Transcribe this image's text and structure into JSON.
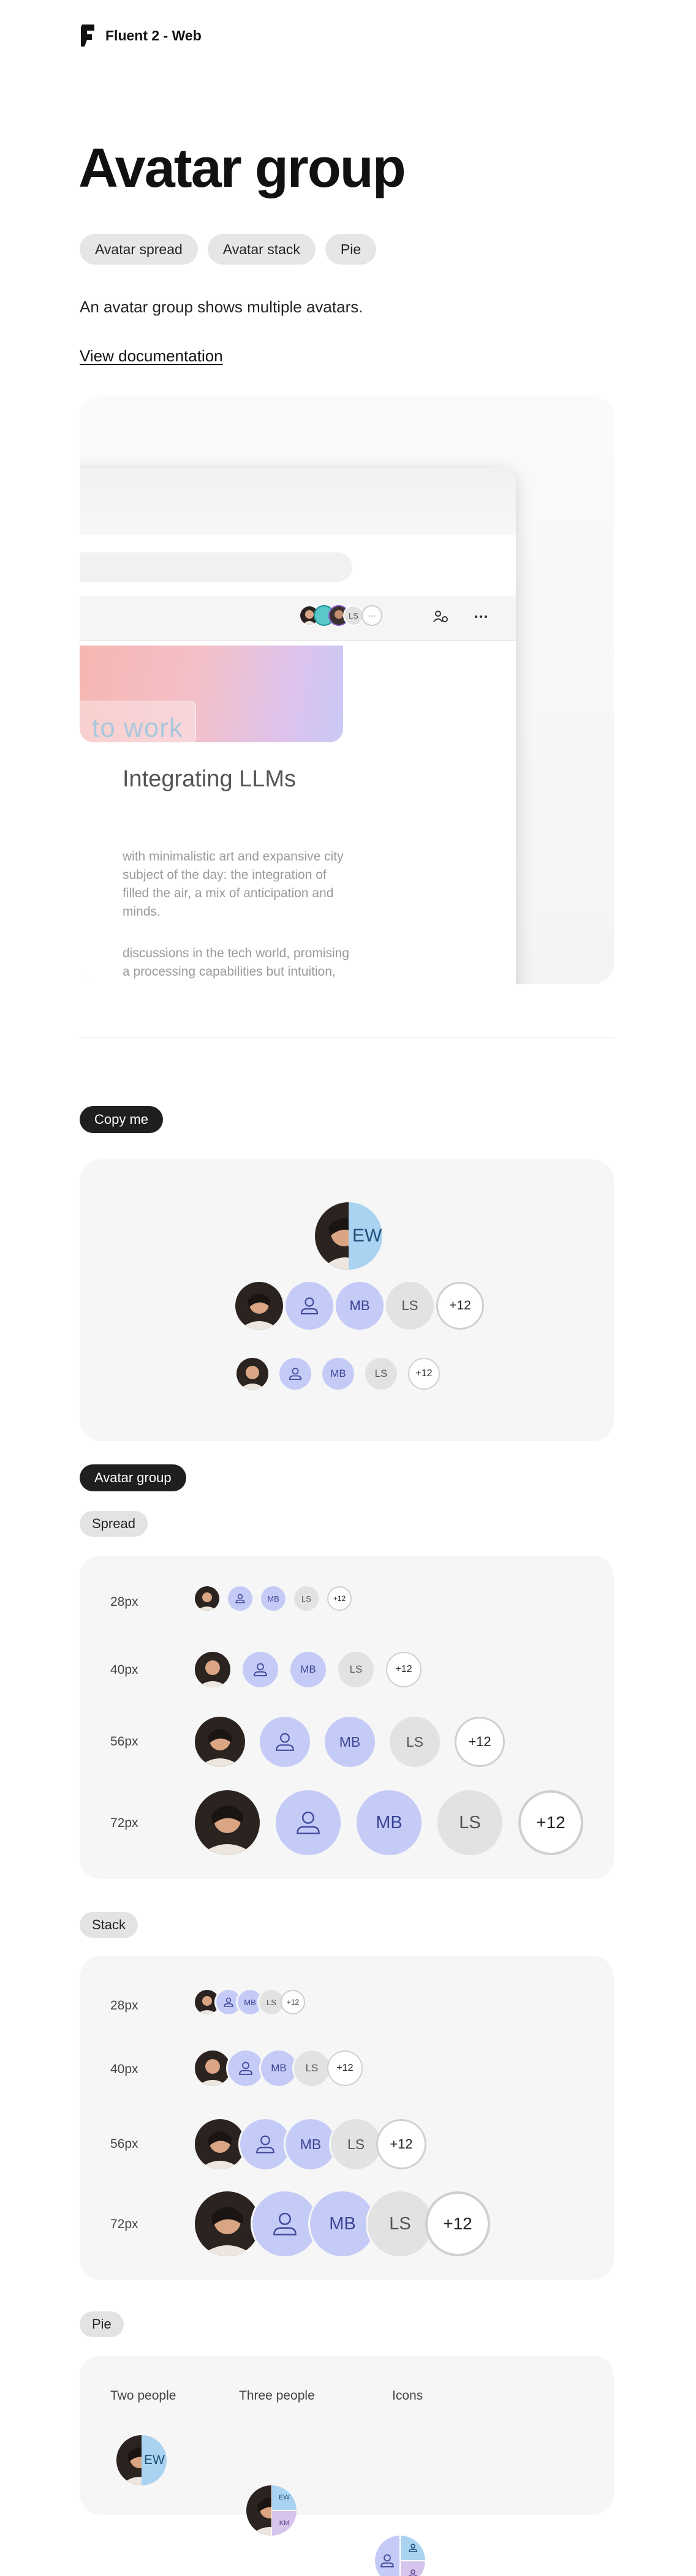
{
  "header": {
    "brand": "Fluent 2 - Web"
  },
  "page": {
    "title": "Avatar group",
    "tags": [
      "Avatar spread",
      "Avatar stack",
      "Pie"
    ],
    "description": "An avatar group shows multiple avatars.",
    "doc_link": "View documentation"
  },
  "preview": {
    "card_word": "to work",
    "heading": "Integrating LLMs",
    "para1": "with minimalistic art and expansive city subject of the day: the integration of filled the air, a mix of anticipation and minds.",
    "para2": "discussions in the tech world, promising a processing capabilities but intuition,",
    "toolbar_initials": "LS",
    "toolbar_more": "···"
  },
  "copy_me": {
    "label": "Copy me",
    "pie_initials": "EW",
    "row_initials": [
      "MB",
      "LS"
    ],
    "overflow": "+12"
  },
  "avatar_group": {
    "label": "Avatar group",
    "spread": {
      "label": "Spread",
      "sizes": [
        "28px",
        "40px",
        "56px",
        "72px"
      ],
      "initials": [
        "MB",
        "LS"
      ],
      "overflow": "+12"
    },
    "stack": {
      "label": "Stack",
      "sizes": [
        "28px",
        "40px",
        "56px",
        "72px"
      ],
      "initials": [
        "MB",
        "LS"
      ],
      "overflow": "+12"
    },
    "pie": {
      "label": "Pie",
      "columns": [
        "Two people",
        "Three people",
        "Icons"
      ],
      "two_initials": "EW",
      "three_initials": [
        "EW",
        "KM"
      ]
    }
  },
  "colors": {
    "person_bg": "#c5cbf7",
    "neutral_bg": "#e2e2e2",
    "ew_bg": "#a9d3f0",
    "km_bg": "#d6c4ec",
    "pill_dark": "#1f1f1f"
  }
}
